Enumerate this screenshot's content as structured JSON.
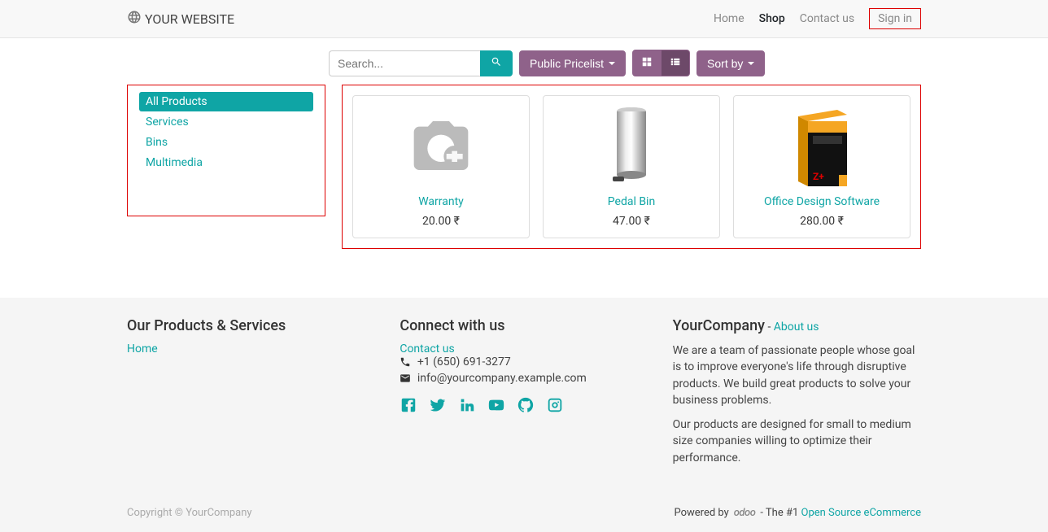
{
  "brand": "YOUR WEBSITE",
  "nav": {
    "home": "Home",
    "shop": "Shop",
    "contact": "Contact us",
    "signin": "Sign in"
  },
  "search": {
    "placeholder": "Search..."
  },
  "toolbar": {
    "pricelist": "Public Pricelist",
    "sortby": "Sort by"
  },
  "categories": [
    {
      "label": "All Products",
      "active": true
    },
    {
      "label": "Services",
      "active": false
    },
    {
      "label": "Bins",
      "active": false
    },
    {
      "label": "Multimedia",
      "active": false
    }
  ],
  "products": [
    {
      "name": "Warranty",
      "price": "20.00 ₹"
    },
    {
      "name": "Pedal Bin",
      "price": "47.00 ₹"
    },
    {
      "name": "Office Design Software",
      "price": "280.00 ₹"
    }
  ],
  "footer": {
    "col1": {
      "title": "Our Products & Services",
      "home": "Home"
    },
    "col2": {
      "title": "Connect with us",
      "contact": "Contact us",
      "phone": "+1 (650) 691-3277",
      "email": "info@yourcompany.example.com"
    },
    "col3": {
      "company": "YourCompany",
      "dash": " - ",
      "about": "About us",
      "para1": "We are a team of passionate people whose goal is to improve everyone's life through disruptive products. We build great products to solve your business problems.",
      "para2": "Our products are designed for small to medium size companies willing to optimize their performance."
    },
    "bottom": {
      "copyright": "Copyright © YourCompany",
      "powered": "Powered by",
      "odoo": "odoo",
      "tag": " - The #1 ",
      "oss": "Open Source eCommerce"
    }
  }
}
